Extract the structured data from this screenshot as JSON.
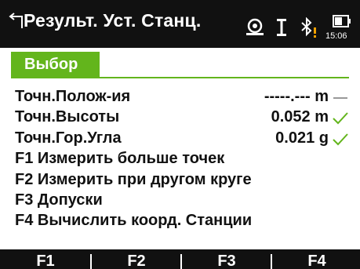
{
  "header": {
    "title": "Результ. Уст. Станц.",
    "time": "15:06",
    "icons": [
      "back-arrow-icon",
      "target-icon",
      "cursor-icon",
      "bluetooth-icon",
      "battery-icon"
    ]
  },
  "tab": {
    "label": "Выбор"
  },
  "results": [
    {
      "label": "Точн.Полож-ия",
      "value": "-----.--- m",
      "status": "dash"
    },
    {
      "label": "Точн.Высоты",
      "value": "0.052 m",
      "status": "check"
    },
    {
      "label": "Точн.Гор.Угла",
      "value": "0.021 g",
      "status": "check"
    }
  ],
  "options": [
    "F1 Измерить больше точек",
    "F2 Измерить при другом круге",
    "F3 Допуски",
    "F4 Вычислить коорд. Станции"
  ],
  "softkeys": [
    "F1",
    "F2",
    "F3",
    "F4"
  ],
  "colors": {
    "accent": "#63b51c",
    "bar": "#111111",
    "warning": "#f0a000"
  }
}
